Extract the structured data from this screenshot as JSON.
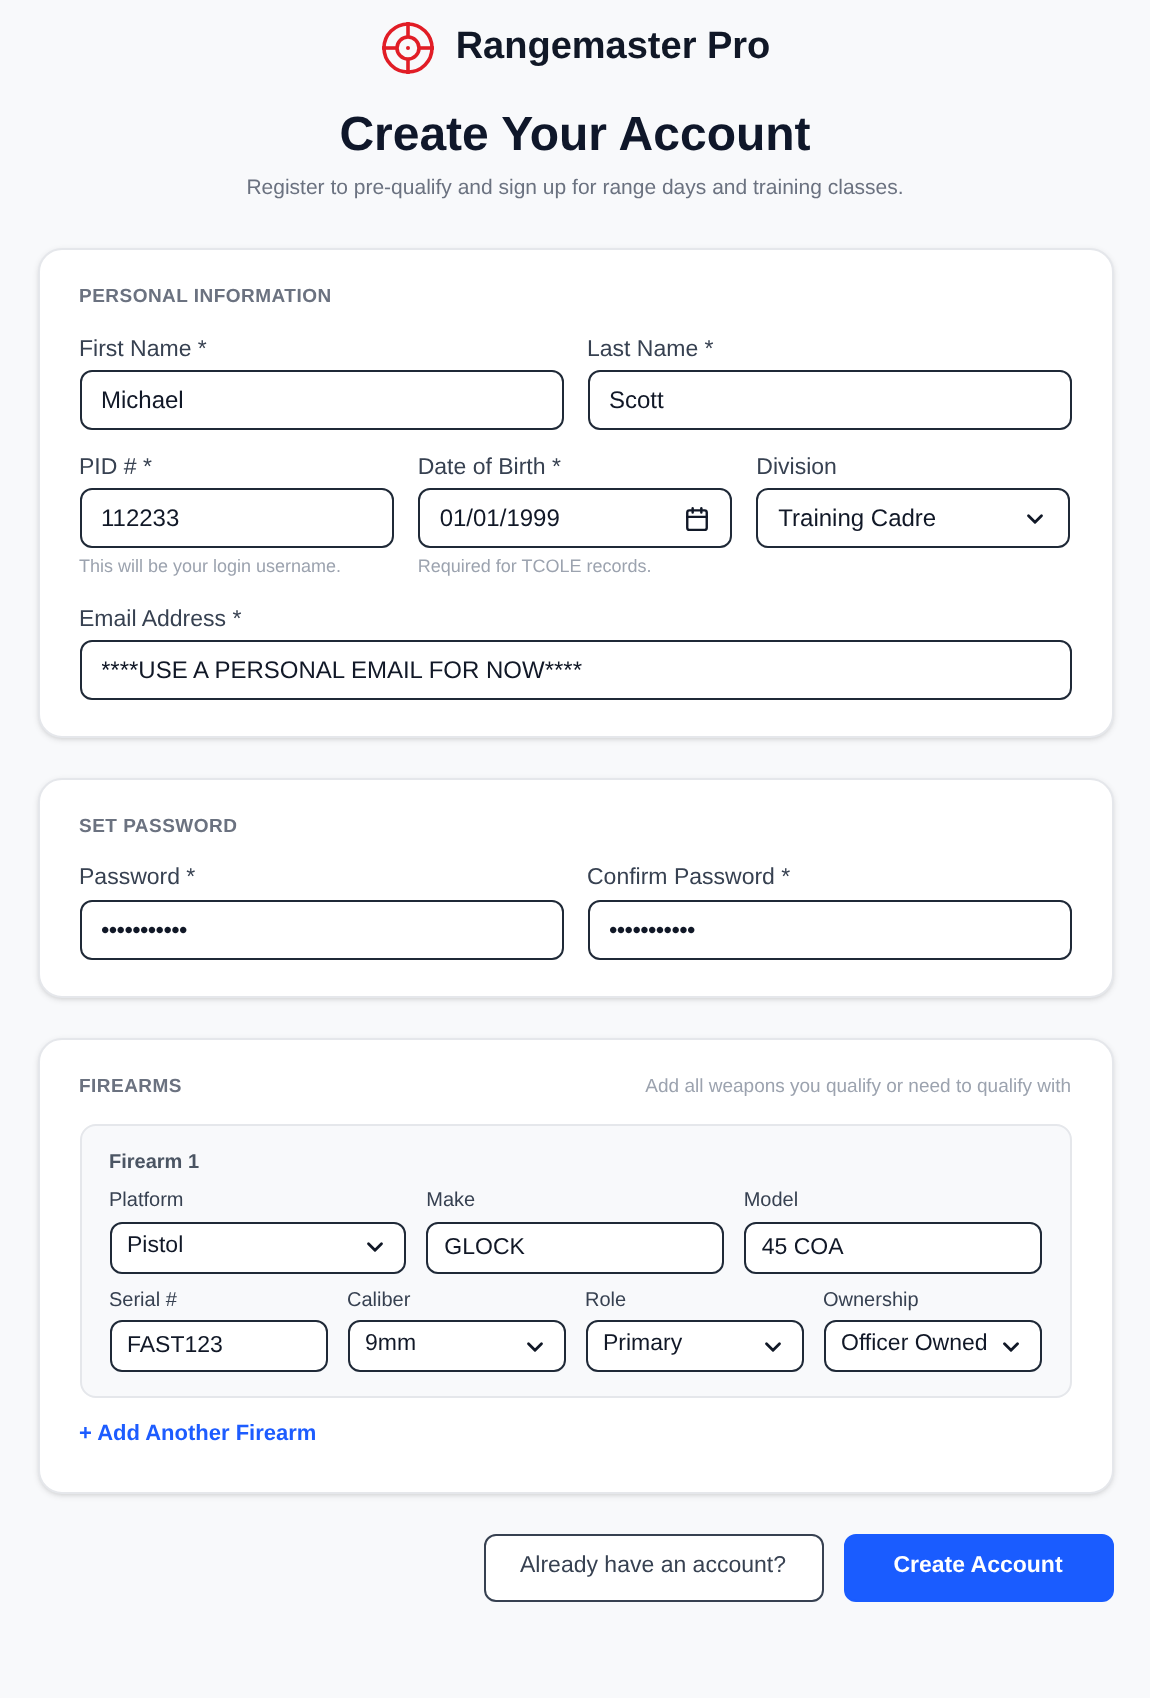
{
  "brand": {
    "name": "Rangemaster Pro"
  },
  "title": "Create Your Account",
  "subtitle": "Register to pre-qualify and sign up for range days and training classes.",
  "sections": [
    {
      "title": "PERSONAL INFORMATION",
      "rows": [
        [
          {
            "label": "First Name *",
            "kind": "text",
            "value": "Michael"
          },
          {
            "label": "Last Name *",
            "kind": "text",
            "value": "Scott"
          }
        ],
        [
          {
            "label": "PID # *",
            "kind": "text",
            "value": "112233",
            "hint": "This will be your login username."
          },
          {
            "label": "Date of Birth *",
            "kind": "date",
            "value": "01/01/1999",
            "hint": "Required for TCOLE records."
          },
          {
            "label": "Division",
            "kind": "select",
            "value": "Training Cadre"
          }
        ],
        [
          {
            "label": "Email Address *",
            "kind": "text",
            "value": "****USE A PERSONAL EMAIL FOR NOW****"
          }
        ]
      ]
    },
    {
      "title": "SET PASSWORD",
      "rows": [
        [
          {
            "label": "Password *",
            "kind": "password",
            "value": "•••••••••••"
          },
          {
            "label": "Confirm Password *",
            "kind": "password",
            "value": "•••••••••••"
          }
        ]
      ]
    },
    {
      "title": "FIREARMS",
      "note": "Add all weapons you qualify or need to qualify with",
      "firearms": [
        {
          "title": "Firearm 1",
          "rows": [
            [
              {
                "label": "Platform",
                "kind": "select",
                "value": "Pistol"
              },
              {
                "label": "Make",
                "kind": "text",
                "value": "GLOCK"
              },
              {
                "label": "Model",
                "kind": "text",
                "value": "45 COA"
              }
            ],
            [
              {
                "label": "Serial #",
                "kind": "text",
                "value": "FAST123"
              },
              {
                "label": "Caliber",
                "kind": "select",
                "value": "9mm"
              },
              {
                "label": "Role",
                "kind": "select",
                "value": "Primary"
              },
              {
                "label": "Ownership",
                "kind": "select",
                "value": "Officer Owned"
              }
            ]
          ]
        }
      ],
      "add_link": "+ Add Another Firearm"
    }
  ],
  "buttons": [
    {
      "label": "Already have an account?",
      "kind": "secondary"
    },
    {
      "label": "Create Account",
      "kind": "primary"
    }
  ]
}
